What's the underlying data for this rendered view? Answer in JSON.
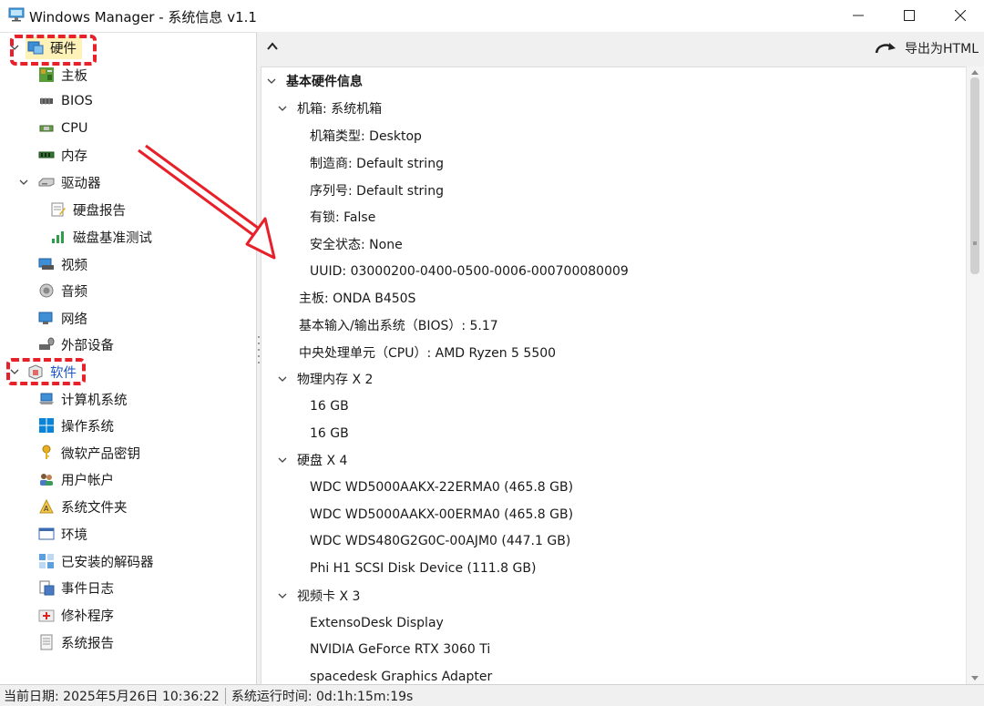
{
  "window": {
    "title": "Windows Manager - 系统信息 v1.1"
  },
  "left_tree": {
    "hardware": {
      "label": "硬件",
      "items": {
        "motherboard": "主板",
        "bios": "BIOS",
        "cpu": "CPU",
        "memory": "内存",
        "drives": "驱动器",
        "disk_report": "硬盘报告",
        "disk_benchmark": "磁盘基准测试",
        "video": "视频",
        "audio": "音频",
        "network": "网络",
        "peripherals": "外部设备"
      }
    },
    "software": {
      "label": "软件",
      "items": {
        "computer_system": "计算机系统",
        "os": "操作系统",
        "product_keys": "微软产品密钥",
        "user_accounts": "用户帐户",
        "system_folders": "系统文件夹",
        "environment": "环境",
        "codecs": "已安装的解码器",
        "event_log": "事件日志",
        "patches": "修补程序",
        "system_report": "系统报告"
      }
    }
  },
  "toolbar": {
    "export_label": "导出为HTML"
  },
  "details": {
    "section_title": "基本硬件信息",
    "chassis": {
      "label": "机箱: 系统机箱",
      "type": "机箱类型: Desktop",
      "manufacturer": "制造商: Default string",
      "serial": "序列号: Default string",
      "locked": "有锁: False",
      "security": "安全状态: None",
      "uuid": "UUID: 03000200-0400-0500-0006-000700080009"
    },
    "motherboard": "主板: ONDA B450S",
    "bios": "基本输入/输出系统（BIOS）: 5.17",
    "cpu": "中央处理单元（CPU）: AMD Ryzen 5 5500",
    "memory": {
      "label": "物理内存 X 2",
      "modules": [
        "16 GB",
        "16 GB"
      ]
    },
    "disks": {
      "label": "硬盘 X 4",
      "items": [
        "WDC WD5000AAKX-22ERMA0 (465.8 GB)",
        "WDC WD5000AAKX-00ERMA0 (465.8 GB)",
        "WDC WDS480G2G0C-00AJM0 (447.1 GB)",
        "Phi H1 SCSI Disk Device (111.8 GB)"
      ]
    },
    "video_cards": {
      "label": "视频卡 X 3",
      "items": [
        "ExtensoDesk Display",
        "NVIDIA GeForce RTX 3060 Ti",
        "spacedesk Graphics Adapter"
      ]
    }
  },
  "statusbar": {
    "date": "当前日期: 2025年5月26日 10:36:22",
    "uptime": "系统运行时间: 0d:1h:15m:19s"
  },
  "colors": {
    "annotation_red": "#e8202a",
    "selection_highlight": "#fff2b8",
    "software_label_blue": "#1a56c4"
  }
}
